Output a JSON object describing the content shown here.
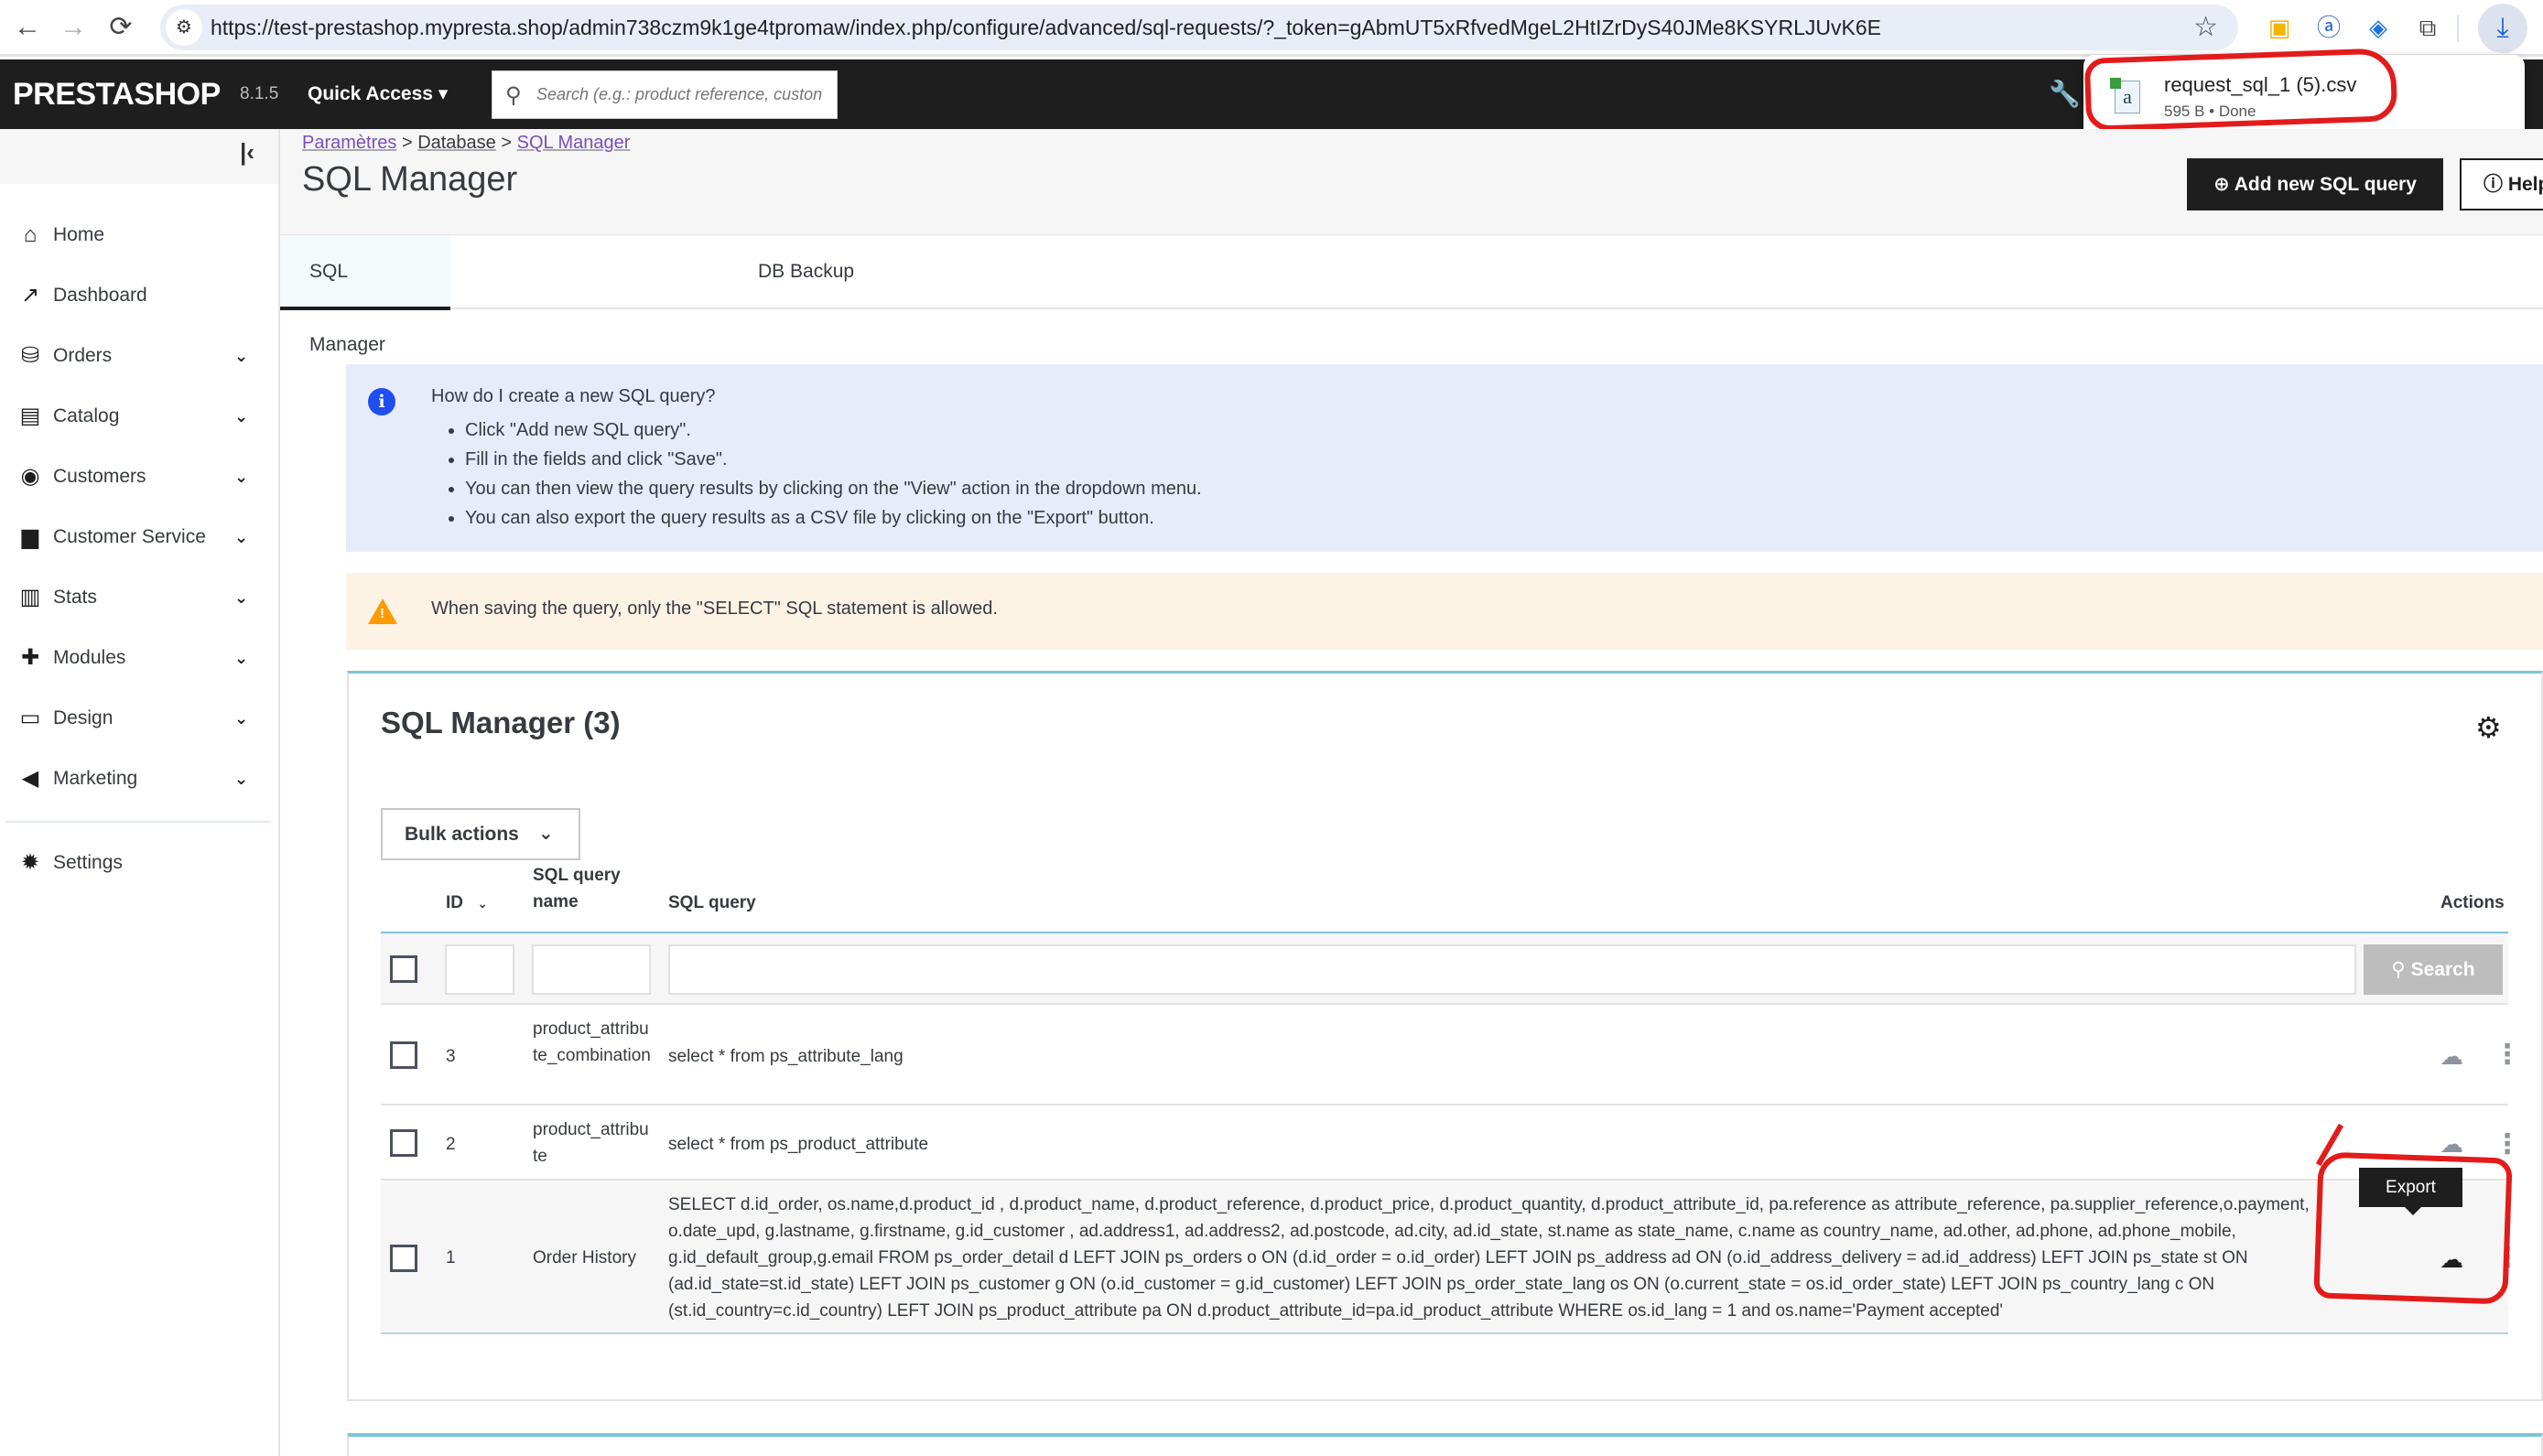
{
  "browser": {
    "url": "https://test-prestashop.mypresta.shop/admin738czm9k1ge4tpromaw/index.php/configure/advanced/sql-requests/?_token=gAbmUT5xRfvedMgeL2HtIZrDyS40JMe8KSYRLJUvK6E",
    "icons": {
      "back": "←",
      "forward": "→",
      "reload": "⟳",
      "site_info": "⚙",
      "bookmark": "☆",
      "extension_1": "▣",
      "extension_2": "ⓐ",
      "extension_3": "◈",
      "extensions": "⧉",
      "downloads": "⤓"
    },
    "download": {
      "file_name": "request_sql_1 (5).csv",
      "status": "595 B • Done",
      "file_icon": "a"
    }
  },
  "header": {
    "logo": "PRESTASHOP",
    "version": "8.1.5",
    "quick_access": "Quick Access ▾",
    "search_placeholder": "Search (e.g.: product reference, custon",
    "search_icon": "⚲",
    "wrench_icon": "🔧"
  },
  "sidebar": {
    "collapse_icon": "|‹",
    "items": [
      {
        "label": "Home",
        "icon": "⌂",
        "expandable": false
      },
      {
        "label": "Dashboard",
        "icon": "↗",
        "expandable": false
      },
      {
        "label": "Orders",
        "icon": "⛁",
        "expandable": true
      },
      {
        "label": "Catalog",
        "icon": "▤",
        "expandable": true
      },
      {
        "label": "Customers",
        "icon": "◉",
        "expandable": true
      },
      {
        "label": "Customer Service",
        "icon": "▆",
        "expandable": true
      },
      {
        "label": "Stats",
        "icon": "▥",
        "expandable": true
      },
      {
        "label": "Modules",
        "icon": "✚",
        "expandable": true
      },
      {
        "label": "Design",
        "icon": "▭",
        "expandable": true
      },
      {
        "label": "Marketing",
        "icon": "◀",
        "expandable": true
      },
      {
        "label": "Settings",
        "icon": "✹",
        "expandable": false
      }
    ],
    "chevron": "⌄"
  },
  "page": {
    "breadcrumb": [
      "Paramètres",
      "Database",
      "SQL Manager"
    ],
    "breadcrumb_sep": ">",
    "title": "SQL Manager",
    "add_button": "⊕ Add new SQL query",
    "help_button": "ⓘ Help",
    "tabs": [
      {
        "label": "SQL Manager",
        "active": true
      },
      {
        "label": "DB Backup",
        "active": false
      }
    ]
  },
  "alerts": {
    "info": {
      "icon": "i",
      "title": "How do I create a new SQL query?",
      "items": [
        "Click \"Add new SQL query\".",
        "Fill in the fields and click \"Save\".",
        "You can then view the query results by clicking on the \"View\" action in the dropdown menu.",
        "You can also export the query results as a CSV file by clicking on the \"Export\" button."
      ]
    },
    "warning": {
      "icon": "!",
      "text": "When saving the query, only the \"SELECT\" SQL statement is allowed."
    }
  },
  "panel": {
    "title": "SQL Manager (3)",
    "gear_icon": "⚙",
    "bulk_actions": "Bulk actions",
    "bulk_chevron": "⌄",
    "columns": {
      "id": "ID",
      "id_sort": "⌄",
      "name_line1": "SQL query",
      "name_line2": "name",
      "query": "SQL query",
      "actions": "Actions"
    },
    "search_button": "⚲ Search",
    "rows": [
      {
        "id": "3",
        "name": "product_attribute_combination",
        "query": "select * from ps_attribute_lang"
      },
      {
        "id": "2",
        "name": "product_attribute",
        "query": "select * from ps_product_attribute"
      },
      {
        "id": "1",
        "name": "Order History",
        "query": "SELECT d.id_order, os.name,d.product_id , d.product_name, d.product_reference, d.product_price, d.product_quantity, d.product_attribute_id, pa.reference as attribute_reference, pa.supplier_reference,o.payment, o.date_upd, g.lastname, g.firstname, g.id_customer , ad.address1, ad.address2, ad.postcode, ad.city, ad.id_state, st.name as state_name, c.name as country_name, ad.other, ad.phone, ad.phone_mobile, g.id_default_group,g.email FROM ps_order_detail d LEFT JOIN ps_orders o ON (d.id_order = o.id_order) LEFT JOIN ps_address ad ON (o.id_address_delivery = ad.id_address) LEFT JOIN ps_state st ON (ad.id_state=st.id_state) LEFT JOIN ps_customer g ON (o.id_customer = g.id_customer) LEFT JOIN ps_order_state_lang os ON (o.current_state = os.id_order_state) LEFT JOIN ps_country_lang c ON (st.id_country=c.id_country) LEFT JOIN ps_product_attribute pa ON d.product_attribute_id=pa.id_product_attribute WHERE os.id_lang = 1 and os.name='Payment accepted'"
      }
    ],
    "export_icon": "☁",
    "kebab_icon": "⋮",
    "tooltip": "Export"
  },
  "colors": {
    "header_bg": "#1e1e1e",
    "accent_teal": "#7cc4d6",
    "info_bg": "#e7ecfb",
    "info_icon": "#1f4ff0",
    "warning_bg": "#fdf3e5",
    "warning_icon": "#ff9a00",
    "annotation_red": "#e31b1b"
  }
}
